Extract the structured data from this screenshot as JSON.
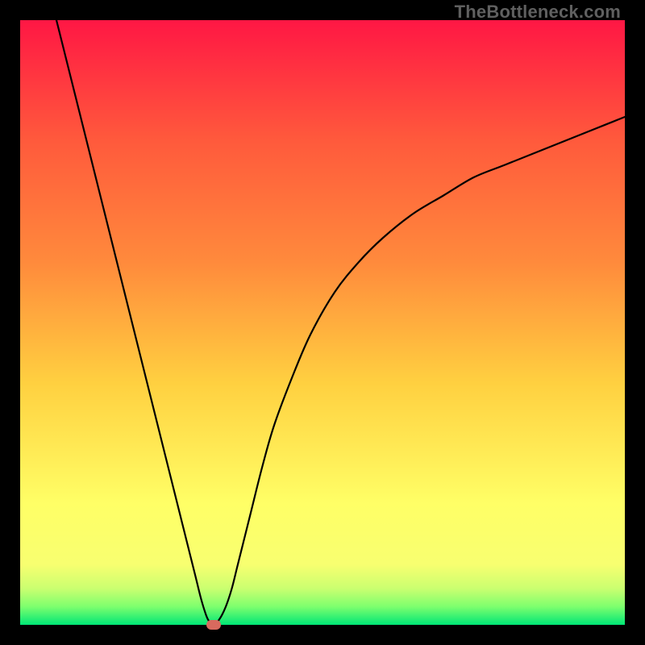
{
  "watermark": "TheBottleneck.com",
  "chart_data": {
    "type": "line",
    "title": "",
    "xlabel": "",
    "ylabel": "",
    "xlim": [
      0,
      100
    ],
    "ylim": [
      0,
      100
    ],
    "grid": false,
    "background_gradient": {
      "bottom": "#00e676",
      "lower": "#caff70",
      "mid_low": "#ffff66",
      "mid": "#ffd040",
      "mid_high": "#ff8a3c",
      "top": "#ff1744"
    },
    "series": [
      {
        "name": "bottleneck-curve",
        "color": "#000000",
        "x": [
          6,
          8,
          10,
          12,
          14,
          16,
          18,
          20,
          22,
          24,
          26,
          27,
          28,
          29,
          30,
          31,
          32,
          33,
          34,
          35,
          36,
          38,
          40,
          42,
          45,
          48,
          52,
          56,
          60,
          65,
          70,
          75,
          80,
          85,
          90,
          95,
          100
        ],
        "y": [
          100,
          92,
          84,
          76,
          68,
          60,
          52,
          44,
          36,
          28,
          20,
          16,
          12,
          8,
          4,
          1,
          0,
          1,
          3,
          6,
          10,
          18,
          26,
          33,
          41,
          48,
          55,
          60,
          64,
          68,
          71,
          74,
          76,
          78,
          80,
          82,
          84
        ]
      }
    ],
    "marker": {
      "name": "optimal-point",
      "x": 32,
      "y": 0,
      "color": "#d86a5e"
    }
  }
}
